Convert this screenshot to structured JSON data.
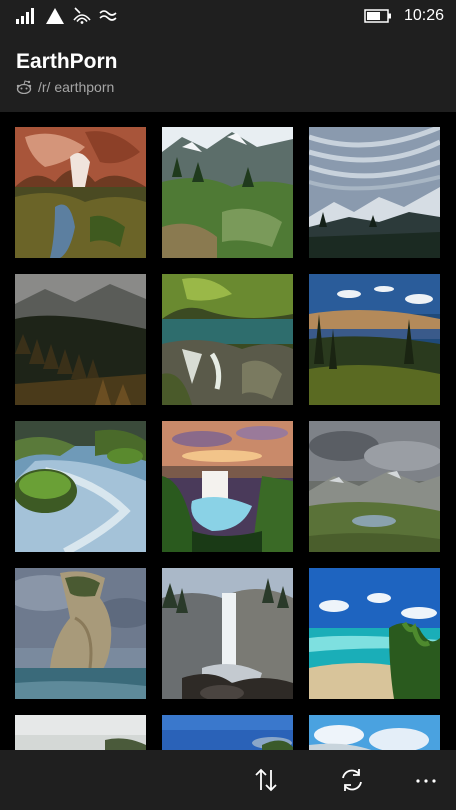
{
  "status_bar": {
    "time": "10:26",
    "icons": [
      "signal-icon",
      "triangle-icon",
      "wifi-icon",
      "data-icon",
      "battery-icon"
    ]
  },
  "header": {
    "title": "EarthPorn",
    "subtitle": "/r/ earthporn",
    "subtitle_icon": "reddit-alien-icon"
  },
  "grid": {
    "tiles": [
      {
        "scene": "red-canyon-pool"
      },
      {
        "scene": "green-mountain-meadow"
      },
      {
        "scene": "streaky-sky-snowcaps"
      },
      {
        "scene": "dark-pine-valley"
      },
      {
        "scene": "mossy-rocks-stream"
      },
      {
        "scene": "lake-sunset-clouds"
      },
      {
        "scene": "misty-river-mossy-rock"
      },
      {
        "scene": "sunset-waterfall"
      },
      {
        "scene": "cloudy-alpine-lake"
      },
      {
        "scene": "sea-stack-rock"
      },
      {
        "scene": "cliff-waterfall"
      },
      {
        "scene": "tropical-beach"
      },
      {
        "scene": "partial-white-sky"
      },
      {
        "scene": "partial-blue-sky"
      },
      {
        "scene": "partial-cloud-sky"
      }
    ]
  },
  "app_bar": {
    "buttons": [
      {
        "icon": "sort-arrows-icon"
      },
      {
        "icon": "refresh-icon"
      },
      {
        "icon": "more-ellipsis-icon"
      }
    ]
  },
  "colors": {
    "chrome_background": "#1f1f1f",
    "grid_background": "#000000",
    "text_primary": "#ffffff",
    "text_secondary": "#a6a6a6"
  }
}
